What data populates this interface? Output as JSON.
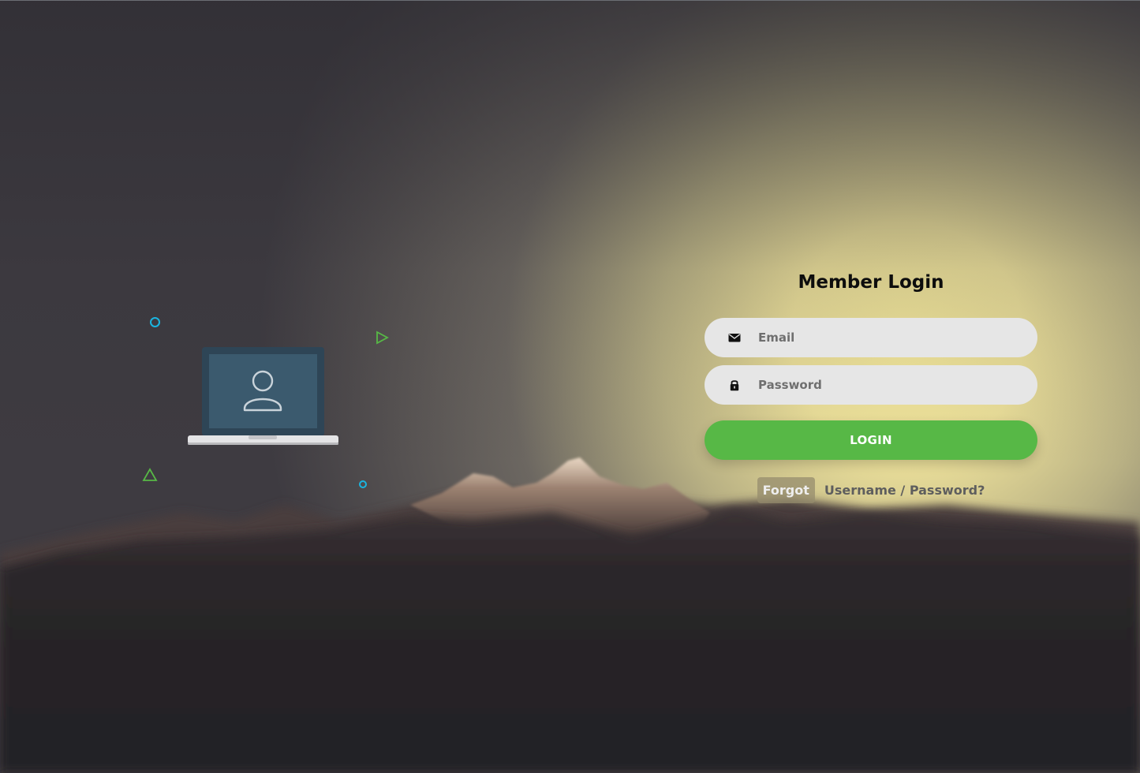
{
  "login": {
    "title": "Member Login",
    "email_placeholder": "Email",
    "password_placeholder": "Password",
    "login_label": "LOGIN",
    "forgot_highlight": "Forgot",
    "forgot_rest": "Username / Password?"
  },
  "icons": {
    "email": "envelope-icon",
    "password": "lock-icon",
    "illustration": "laptop-user-icon"
  },
  "colors": {
    "button": "#57b846",
    "field_background": "#e6e6e6",
    "title": "#0d0d0d",
    "deco_blue": "#1ab5e0",
    "deco_green": "#57b846",
    "laptop_screen": "#3b5a6e",
    "laptop_frame": "#2e4556"
  }
}
